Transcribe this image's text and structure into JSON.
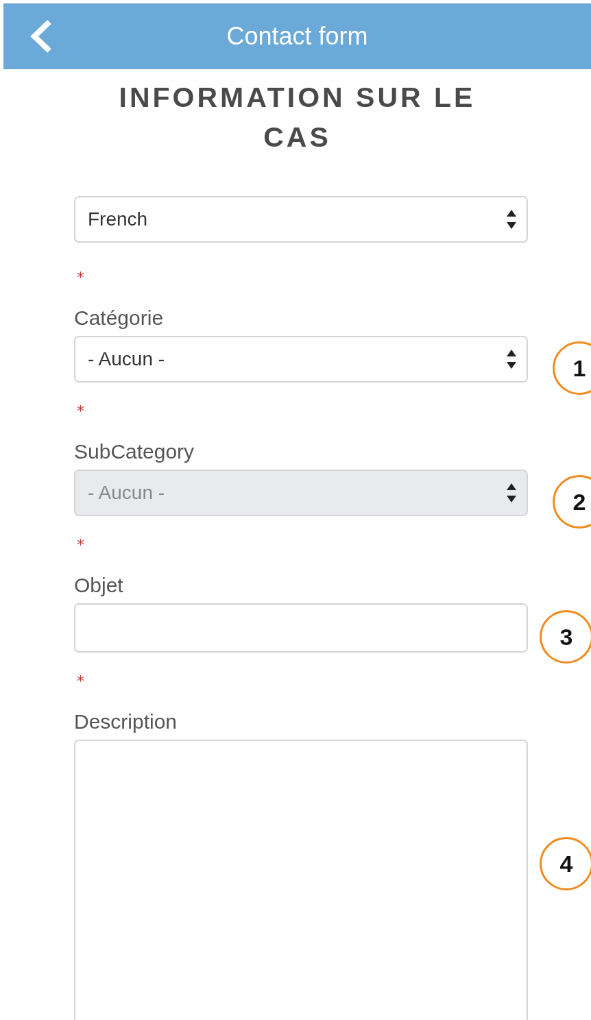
{
  "header": {
    "title": "Contact form"
  },
  "heading": "INFORMATION SUR LE CAS",
  "fields": [
    {
      "kind": "select",
      "value": "French",
      "disabled": false
    },
    {
      "kind": "select",
      "required_mark": "*",
      "label": "Catégorie",
      "value": "- Aucun -",
      "disabled": false,
      "annotation": "1"
    },
    {
      "kind": "select",
      "required_mark": "*",
      "label": "SubCategory",
      "value": "- Aucun -",
      "disabled": true,
      "annotation": "2"
    },
    {
      "kind": "input",
      "required_mark": "*",
      "label": "Objet",
      "disabled": false,
      "annotation": "3"
    },
    {
      "kind": "textarea",
      "required_mark": "*",
      "label": "Description",
      "disabled": false,
      "annotation": "4"
    }
  ]
}
